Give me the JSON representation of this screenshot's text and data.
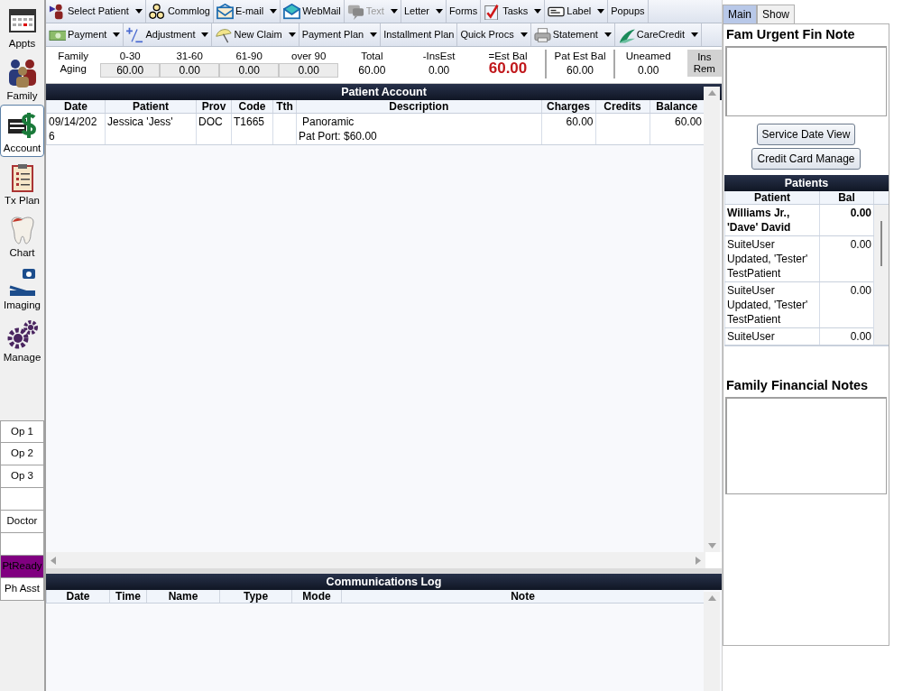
{
  "modules": [
    {
      "label": "Appts",
      "selected": false
    },
    {
      "label": "Family",
      "selected": false
    },
    {
      "label": "Account",
      "selected": true
    },
    {
      "label": "Tx Plan",
      "selected": false
    },
    {
      "label": "Chart",
      "selected": false
    },
    {
      "label": "Imaging",
      "selected": false
    },
    {
      "label": "Manage",
      "selected": false
    }
  ],
  "staff": [
    {
      "kind": "staff",
      "label": "Op 1",
      "color": "#ffffff"
    },
    {
      "kind": "staff",
      "label": "Op 2",
      "color": "#ffffff"
    },
    {
      "kind": "staff",
      "label": "Op 3",
      "color": "#ffffff"
    },
    {
      "kind": "blank",
      "color": "#ffffff"
    },
    {
      "kind": "staff",
      "label": "Doctor",
      "color": "#ffffff"
    },
    {
      "kind": "blank",
      "color": "#ffffff"
    },
    {
      "kind": "staff",
      "label": "PtReady",
      "color": "#800080"
    },
    {
      "kind": "staff",
      "label": "Ph Asst",
      "color": "#ffffff"
    }
  ],
  "toolbar_rows": [
    [
      {
        "label": "Select Patient",
        "dropdown": true,
        "disabled": false
      },
      {
        "label": "Commlog",
        "dropdown": false,
        "disabled": false
      },
      {
        "label": "E-mail",
        "dropdown": true,
        "disabled": false
      },
      {
        "label": "WebMail",
        "dropdown": false,
        "disabled": false
      },
      {
        "label": "Text",
        "dropdown": true,
        "disabled": true
      },
      {
        "label": "Letter",
        "dropdown": true,
        "disabled": false
      },
      {
        "label": "Forms",
        "dropdown": false,
        "disabled": false
      },
      {
        "label": "Tasks",
        "dropdown": true,
        "disabled": false
      },
      {
        "label": "Label",
        "dropdown": true,
        "disabled": false
      },
      {
        "label": "Popups",
        "dropdown": false,
        "disabled": false
      }
    ],
    [
      {
        "label": "Payment",
        "dropdown": true,
        "disabled": false
      },
      {
        "label": "Adjustment",
        "dropdown": true,
        "disabled": false
      },
      {
        "label": "New Claim",
        "dropdown": true,
        "disabled": false
      },
      {
        "label": "Payment Plan",
        "dropdown": true,
        "disabled": false
      },
      {
        "label": "Installment Plan",
        "dropdown": false,
        "disabled": false
      },
      {
        "label": "Quick Procs",
        "dropdown": true,
        "disabled": false
      },
      {
        "label": "Statement",
        "dropdown": true,
        "disabled": false
      },
      {
        "label": "CareCredit",
        "dropdown": true,
        "disabled": false
      }
    ]
  ],
  "aging": {
    "label": "Family Aging",
    "buckets": [
      {
        "label": "0-30",
        "value": "60.00"
      },
      {
        "label": "31-60",
        "value": "0.00"
      },
      {
        "label": "61-90",
        "value": "0.00"
      },
      {
        "label": "over 90",
        "value": "0.00"
      }
    ]
  },
  "totals": [
    {
      "kind": "plain",
      "label": "Total",
      "value": "60.00"
    },
    {
      "kind": "plain",
      "label": "-InsEst",
      "value": "0.00"
    },
    {
      "kind": "emphasis",
      "label": "=Est Bal",
      "value": "60.00"
    },
    {
      "kind": "plain",
      "label": "Pat Est Bal",
      "value": "60.00"
    },
    {
      "kind": "plain",
      "label": "Uneamed",
      "value": "0.00"
    }
  ],
  "ins_rem_button": "Ins Rem",
  "patient_account": {
    "title": "Patient Account",
    "columns": [
      "Date",
      "Patient",
      "Prov",
      "Code",
      "Tth",
      "Description",
      "Charges",
      "Credits",
      "Balance"
    ],
    "rows": [
      {
        "date": "09/14/2026",
        "patient": "Jessica 'Jess'",
        "prov": "DOC",
        "code": "T1665",
        "description": [
          "Panoramic",
          "Pat Port: $60.00"
        ],
        "charges": "60.00",
        "balance": "60.00"
      }
    ]
  },
  "communications_log": {
    "title": "Communications Log",
    "columns": [
      "Date",
      "Time",
      "Name",
      "Type",
      "Mode",
      "Note"
    ]
  },
  "side_panel": {
    "tabs": [
      {
        "label": "Main",
        "selected": true
      },
      {
        "label": "Show",
        "selected": false
      }
    ],
    "urgent_note_heading": "Fam Urgent Fin Note",
    "buttons": [
      "Service Date View",
      "Credit Card Manage"
    ],
    "patients": {
      "title": "Patients",
      "columns": [
        "Patient",
        "Bal"
      ],
      "rows": [
        {
          "name": "Williams Jr., 'Dave' David",
          "bal": "0.00",
          "current": true
        },
        {
          "name": "SuiteUser Updated, 'Tester' TestPatient",
          "bal": "0.00",
          "current": false
        },
        {
          "name": "SuiteUser Updated, 'Tester' TestPatient",
          "bal": "0.00",
          "current": false
        },
        {
          "name": "SuiteUser",
          "bal": "0.00",
          "current": false
        }
      ]
    },
    "financial_notes_heading": "Family Financial Notes"
  }
}
